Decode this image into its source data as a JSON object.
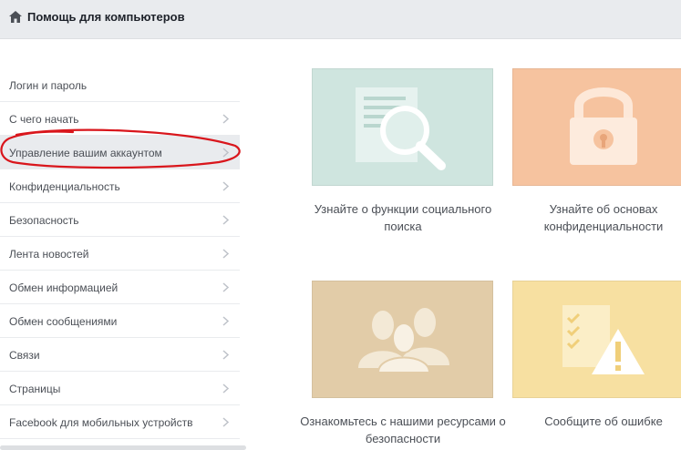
{
  "header": {
    "title": "Помощь для компьютеров",
    "icon": "home-icon"
  },
  "sidebar": {
    "items": [
      {
        "label": "Логин и пароль",
        "chevron": false,
        "active": false
      },
      {
        "label": "С чего начать",
        "chevron": true,
        "active": false
      },
      {
        "label": "Управление вашим аккаунтом",
        "chevron": true,
        "active": true
      },
      {
        "label": "Конфиденциальность",
        "chevron": true,
        "active": false
      },
      {
        "label": "Безопасность",
        "chevron": true,
        "active": false
      },
      {
        "label": "Лента новостей",
        "chevron": true,
        "active": false
      },
      {
        "label": "Обмен информацией",
        "chevron": true,
        "active": false
      },
      {
        "label": "Обмен сообщениями",
        "chevron": true,
        "active": false
      },
      {
        "label": "Связи",
        "chevron": true,
        "active": false
      },
      {
        "label": "Страницы",
        "chevron": true,
        "active": false
      },
      {
        "label": "Facebook для мобильных устройств",
        "chevron": true,
        "active": false
      }
    ]
  },
  "cards": [
    {
      "caption": "Узнайте о функции социального поиска",
      "icon": "magnifier-document-icon",
      "color": "#cfe5df"
    },
    {
      "caption": "Узнайте об основах конфиденциальности",
      "icon": "padlock-icon",
      "color": "#f6c39f"
    },
    {
      "caption": "Ознакомьтесь с нашими ресурсами о безопасности",
      "icon": "people-silhouettes-icon",
      "color": "#e2cca8"
    },
    {
      "caption": "Сообщите об ошибке",
      "icon": "checklist-warning-icon",
      "color": "#f7e0a1"
    }
  ],
  "annotation": {
    "color": "#d9161c"
  }
}
